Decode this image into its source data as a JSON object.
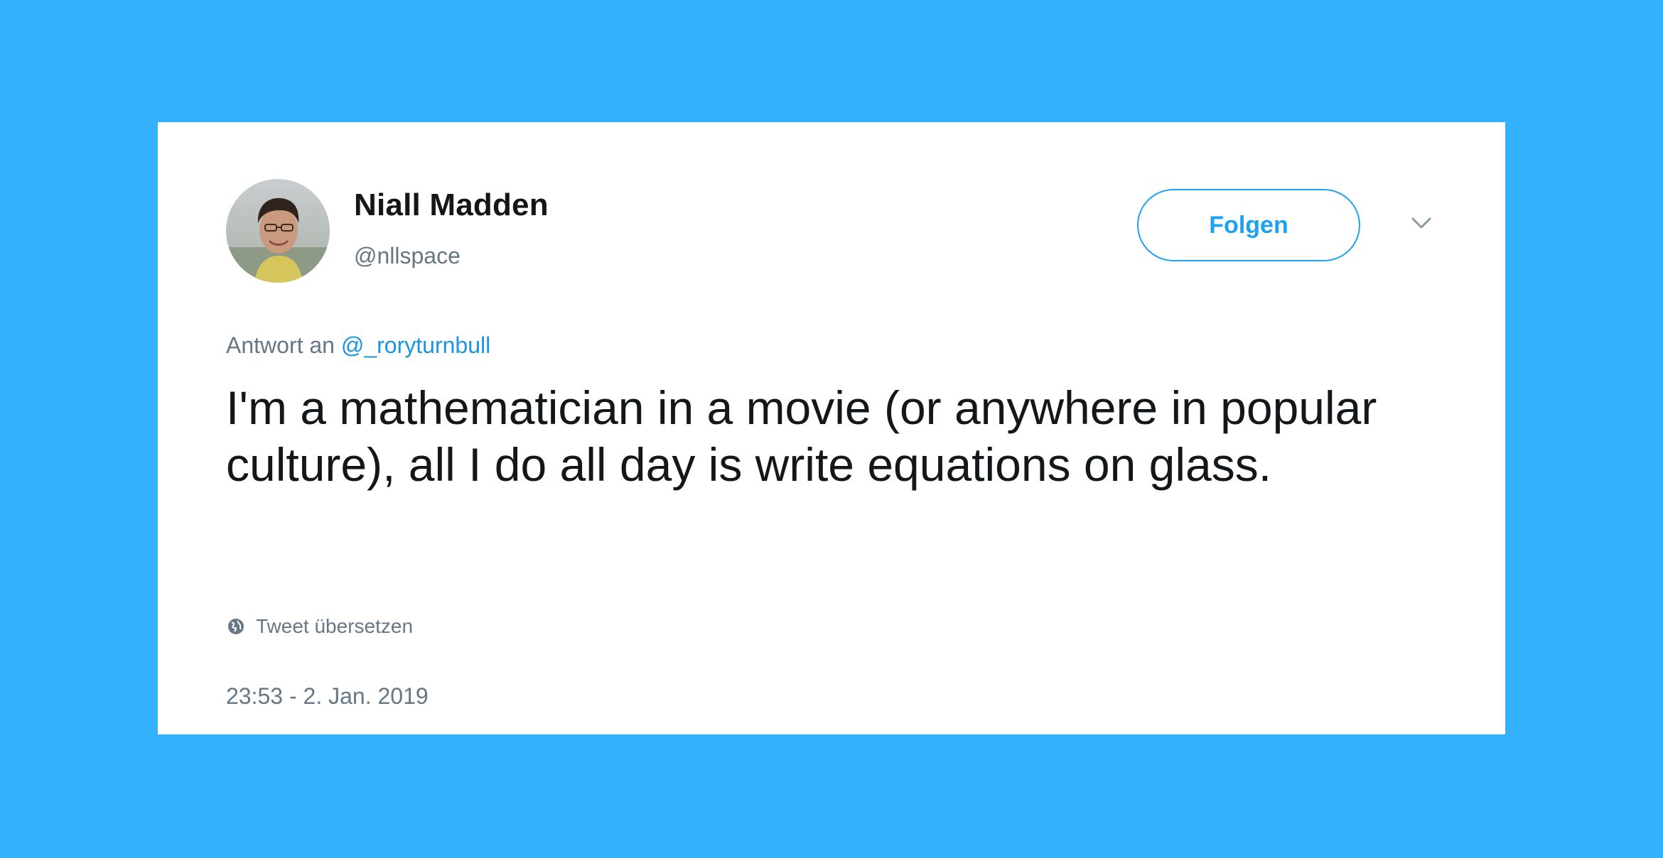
{
  "colors": {
    "background": "#33b1fd",
    "card": "#ffffff",
    "accent": "#1da1f2",
    "text_primary": "#14171a",
    "text_secondary": "#657786"
  },
  "author": {
    "display_name": "Niall Madden",
    "handle": "@nllspace",
    "avatar_icon": "profile-photo"
  },
  "actions": {
    "follow_label": "Folgen",
    "menu_icon": "chevron-down-icon"
  },
  "reply": {
    "prefix": "Antwort an",
    "mention": "@_roryturnbull"
  },
  "tweet": {
    "text": "I'm a mathematician in a movie (or anywhere in popular culture), all I do all day is write equations on glass."
  },
  "translate": {
    "icon": "globe-icon",
    "label": "Tweet übersetzen"
  },
  "timestamp": "23:53 - 2. Jan. 2019"
}
